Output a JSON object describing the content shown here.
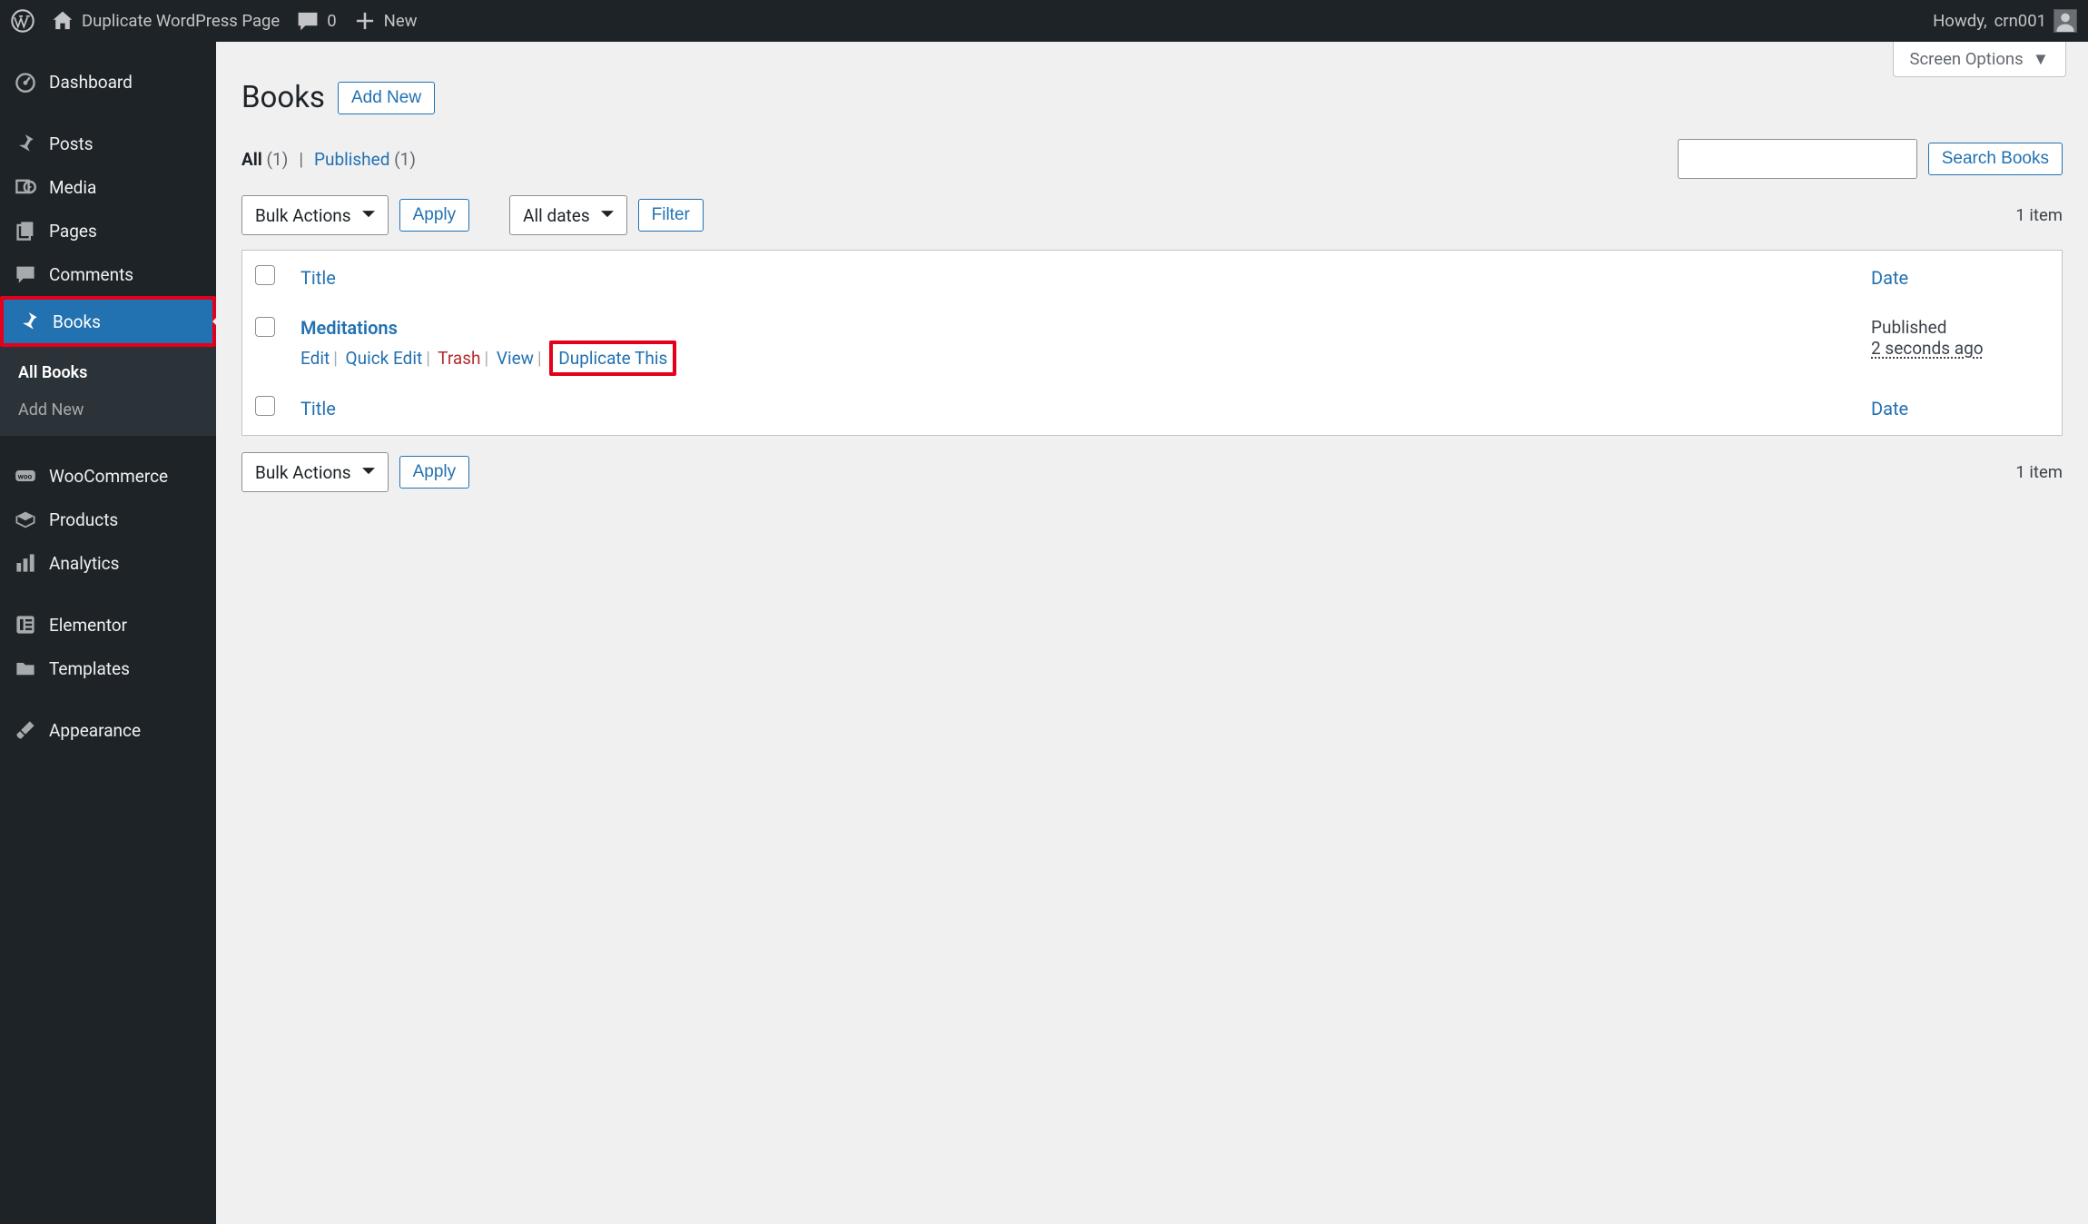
{
  "adminbar": {
    "site_title": "Duplicate WordPress Page",
    "comments_count": "0",
    "new_label": "New",
    "howdy_prefix": "Howdy, ",
    "username": "crn001"
  },
  "sidebar": {
    "items": [
      {
        "label": "Dashboard",
        "icon": "gauge-icon"
      },
      {
        "label": "Posts",
        "icon": "pin-icon"
      },
      {
        "label": "Media",
        "icon": "media-icon"
      },
      {
        "label": "Pages",
        "icon": "page-icon"
      },
      {
        "label": "Comments",
        "icon": "comment-icon"
      },
      {
        "label": "Books",
        "icon": "pin-icon",
        "active": true,
        "highlight": true,
        "subitems": [
          {
            "label": "All Books",
            "current": true
          },
          {
            "label": "Add New"
          }
        ]
      },
      {
        "label": "WooCommerce",
        "icon": "woo-icon"
      },
      {
        "label": "Products",
        "icon": "product-icon"
      },
      {
        "label": "Analytics",
        "icon": "bars-icon"
      },
      {
        "label": "Elementor",
        "icon": "elementor-icon"
      },
      {
        "label": "Templates",
        "icon": "folder-icon"
      },
      {
        "label": "Appearance",
        "icon": "brush-icon"
      }
    ]
  },
  "content": {
    "screen_options": "Screen Options",
    "page_title": "Books",
    "add_new": "Add New",
    "filter_links": {
      "all_label": "All",
      "all_count": "(1)",
      "published_label": "Published",
      "published_count": "(1)"
    },
    "search": {
      "placeholder": "",
      "button": "Search Books"
    },
    "bulk": {
      "bulk_actions": "Bulk Actions",
      "apply": "Apply",
      "dates": "All dates",
      "filter": "Filter"
    },
    "items_count": "1 item",
    "columns": {
      "title": "Title",
      "date": "Date"
    },
    "rows": [
      {
        "title": "Meditations",
        "actions": {
          "edit": "Edit",
          "quick_edit": "Quick Edit",
          "trash": "Trash",
          "view": "View",
          "duplicate": "Duplicate This"
        },
        "date_label": "Published",
        "date_value": "2 seconds ago"
      }
    ]
  }
}
